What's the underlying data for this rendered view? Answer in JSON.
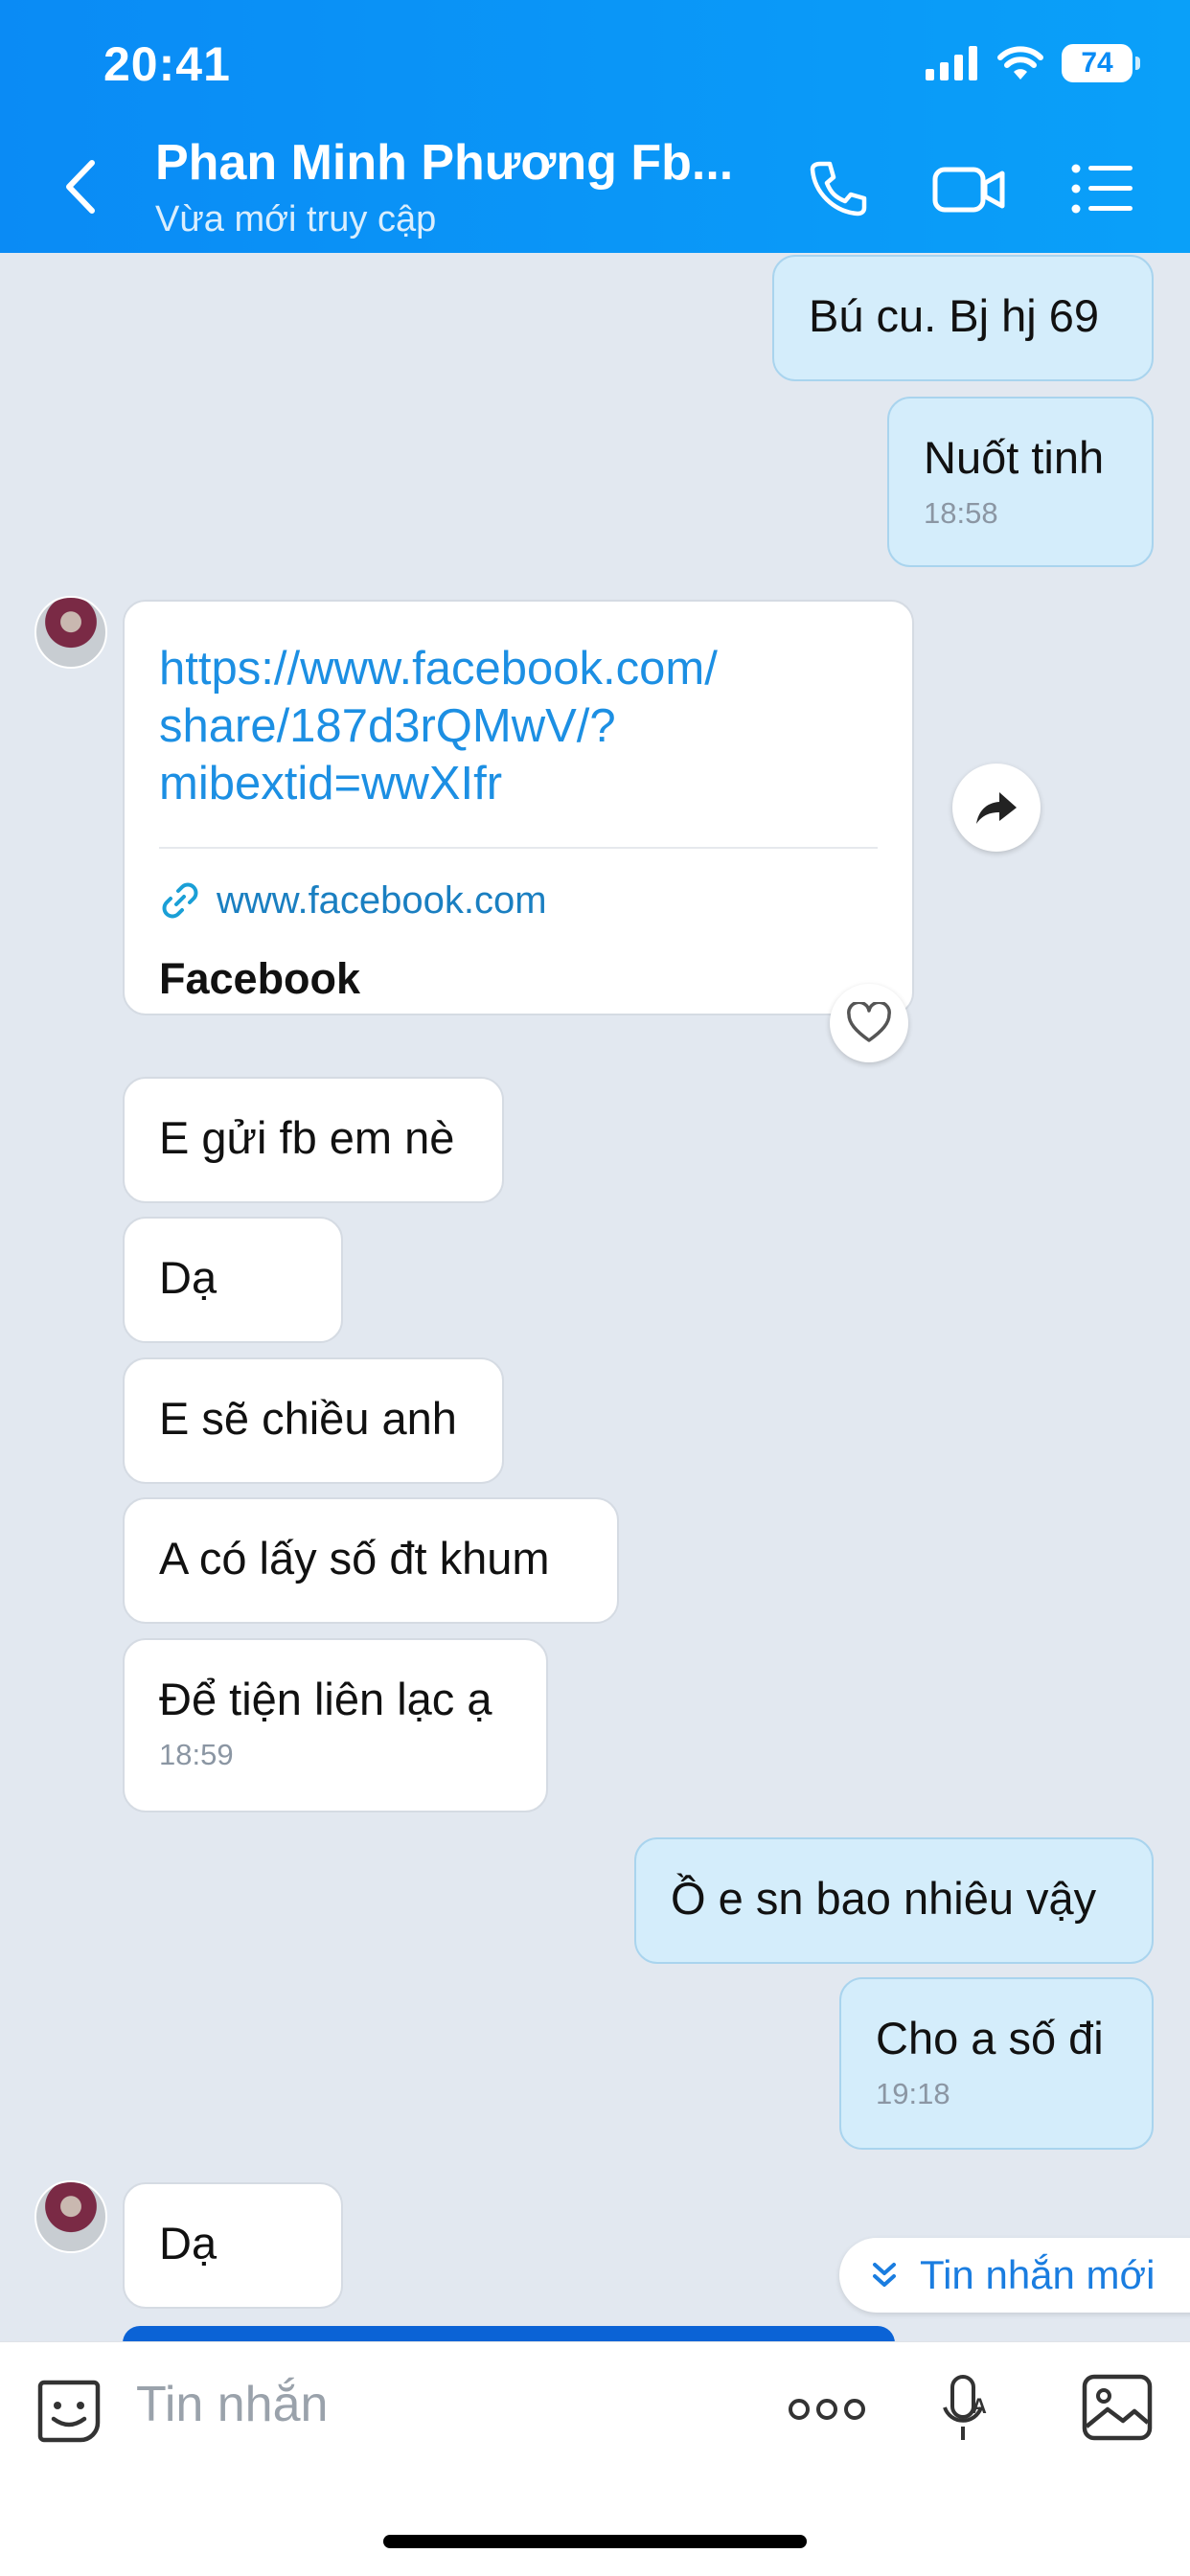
{
  "status_bar": {
    "time": "20:41",
    "battery": "74"
  },
  "header": {
    "title": "Phan Minh Phương Fb...",
    "subtitle": "Vừa mới truy cập",
    "icons": [
      "back-chevron-icon",
      "phone-icon",
      "video-camera-icon",
      "menu-list-icon"
    ]
  },
  "messages": {
    "m1": {
      "text": "Bú cu. Bj hj 69"
    },
    "m2": {
      "text": "Nuốt tinh",
      "time": "18:58"
    },
    "link": {
      "url": "https://www.facebook.com/share/187d3rQMwV/?mibextid=wwXIfr",
      "url_line1": "https://www.facebook.com/",
      "url_line2": "share/187d3rQMwV/?",
      "url_line3": "mibextid=wwXIfr",
      "domain": "www.facebook.com",
      "title": "Facebook"
    },
    "m3": {
      "text": "E gửi fb em nè"
    },
    "m4": {
      "text": "Dạ"
    },
    "m5": {
      "text": "E sẽ chiều anh"
    },
    "m6": {
      "text": "A có lấy số đt khum"
    },
    "m7": {
      "text": "Để tiện liên lạc ạ",
      "time": "18:59"
    },
    "m8": {
      "text": "Ồ e sn bao nhiêu vậy"
    },
    "m9": {
      "text": "Cho a số đi",
      "time": "19:18"
    },
    "m10": {
      "text": "Dạ"
    }
  },
  "new_messages_label": "Tin nhắn mới",
  "input": {
    "placeholder": "Tin nhắn"
  },
  "colors": {
    "header": "#0a8bf5",
    "my_bubble": "#d4edfb",
    "their_bubble": "#ffffff",
    "accent": "#1a7de0"
  }
}
